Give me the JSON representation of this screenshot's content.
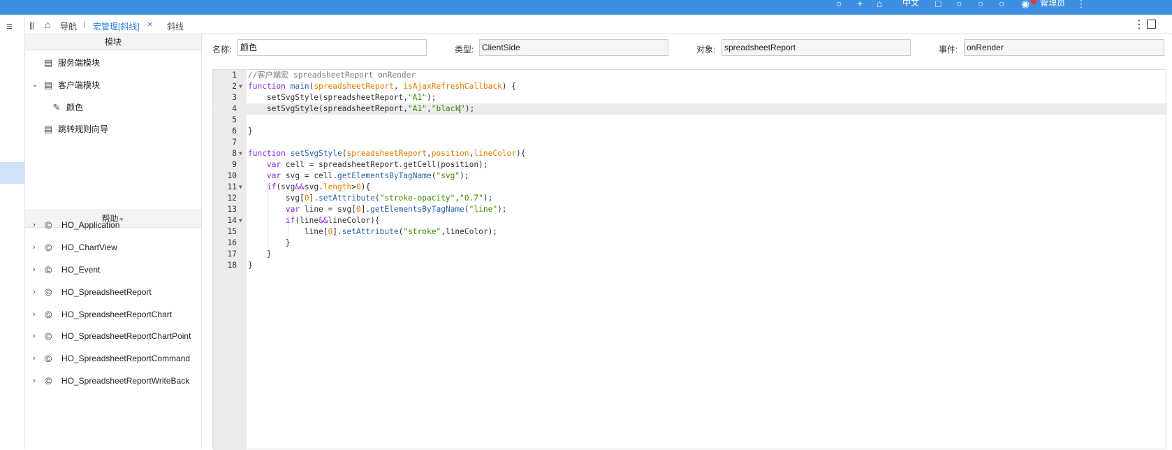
{
  "topbar": {
    "lang": "中文",
    "user": "管理员"
  },
  "tabs": {
    "nav": "导航",
    "active": "宏管理[斜线]",
    "second": "斜线"
  },
  "modules": {
    "header": "模块",
    "server": "服务端模块",
    "client": "客户端模块",
    "color": "颜色",
    "jump": "跳转规则向导"
  },
  "help": {
    "header": "帮助",
    "items": [
      "HO_Application",
      "HO_ChartView",
      "HO_Event",
      "HO_SpreadsheetReport",
      "HO_SpreadsheetReportChart",
      "HO_SpreadsheetReportChartPoint",
      "HO_SpreadsheetReportCommand",
      "HO_SpreadsheetReportWriteBack"
    ]
  },
  "form": {
    "name_label": "名称:",
    "name_value": "颜色",
    "type_label": "类型:",
    "type_value": "ClientSide",
    "object_label": "对象:",
    "object_value": "spreadsheetReport",
    "event_label": "事件:",
    "event_value": "onRender"
  },
  "editor": {
    "line_numbers": [
      "1",
      "2",
      "3",
      "4",
      "5",
      "6",
      "7",
      "8",
      "9",
      "10",
      "11",
      "12",
      "13",
      "14",
      "15",
      "16",
      "17",
      "18"
    ],
    "current_line": 4
  }
}
